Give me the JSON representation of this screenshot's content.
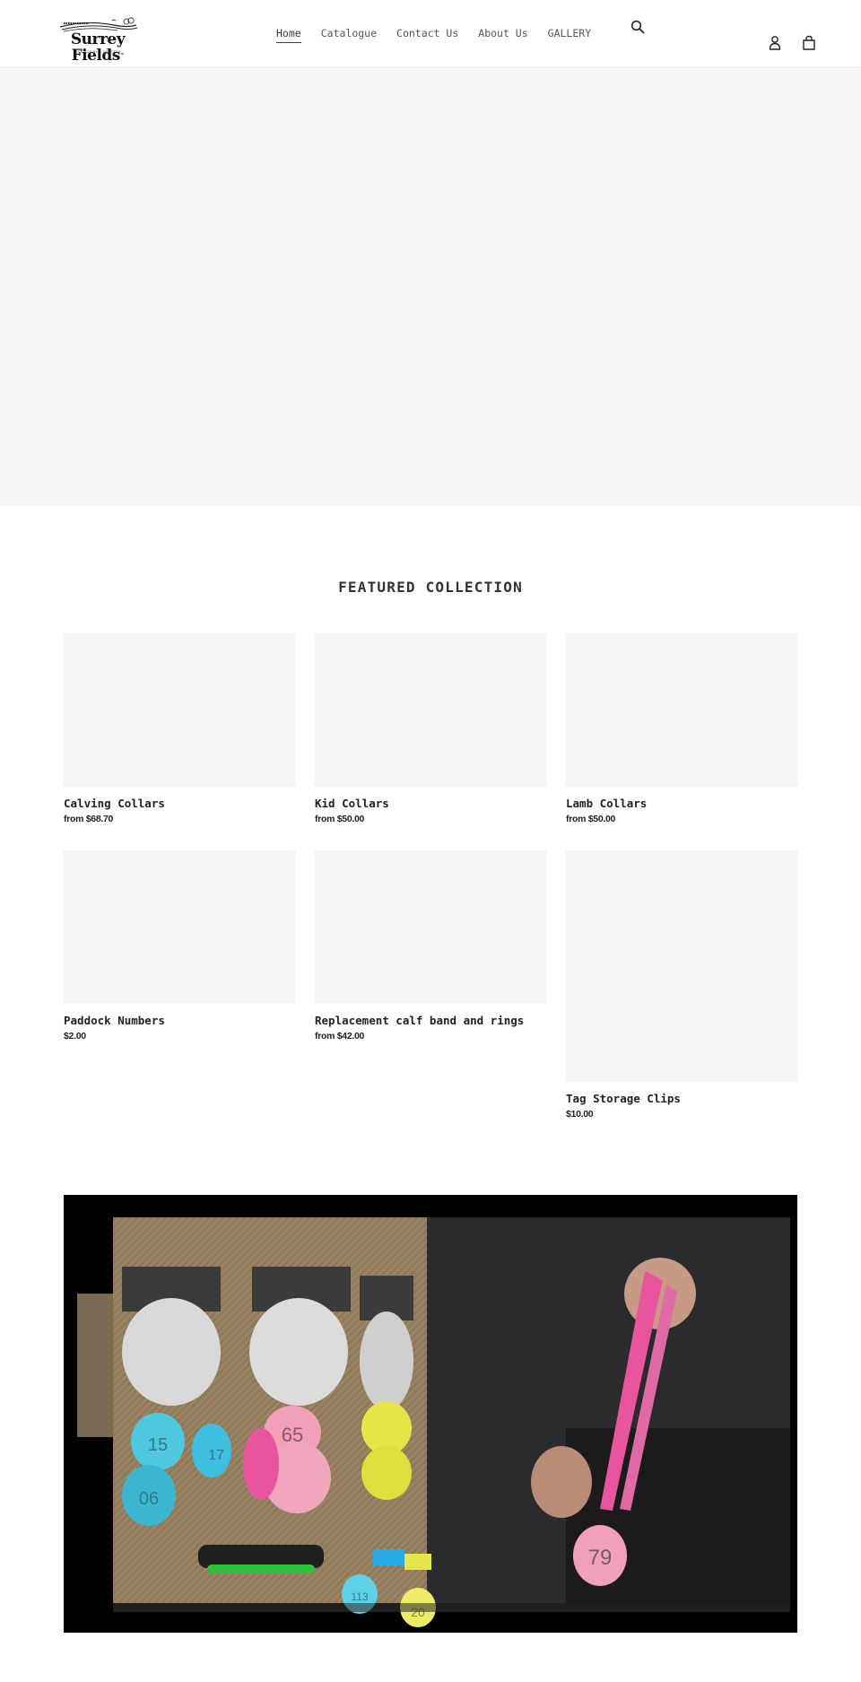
{
  "header": {
    "logo": {
      "name": "Surrey Fields",
      "tagline": "EST 2020 BY K. GRATTAN",
      "trademark": "™"
    },
    "nav": [
      {
        "label": "Home",
        "active": true
      },
      {
        "label": "Catalogue",
        "active": false
      },
      {
        "label": "Contact Us",
        "active": false
      },
      {
        "label": "About Us",
        "active": false
      },
      {
        "label": "GALLERY",
        "active": false
      }
    ],
    "icons": {
      "search": "search-icon",
      "account": "account-icon",
      "cart": "cart-icon"
    }
  },
  "hero": {
    "background": "#f5f5f5"
  },
  "featured": {
    "title": "FEATURED COLLECTION",
    "products": [
      {
        "title": "Calving Collars",
        "price": "from $68.70"
      },
      {
        "title": "Kid Collars",
        "price": "from $50.00"
      },
      {
        "title": "Lamb Collars",
        "price": "from $50.00"
      },
      {
        "title": "Paddock Numbers",
        "price": "$2.00"
      },
      {
        "title": "Replacement calf band and rings",
        "price": "from $42.00"
      },
      {
        "title": "Tag Storage Clips",
        "price": "$10.00"
      }
    ]
  },
  "video": {
    "description": "Calving collars product demonstration",
    "tag_numbers": [
      "15",
      "17",
      "06",
      "65",
      "79",
      "113",
      "20"
    ]
  },
  "colors": {
    "placeholder": "#f5f5f5",
    "text": "#3a3a3a",
    "accent_pink": "#e8559c",
    "accent_cyan": "#4dc8de",
    "accent_yellow": "#e6e64a"
  }
}
